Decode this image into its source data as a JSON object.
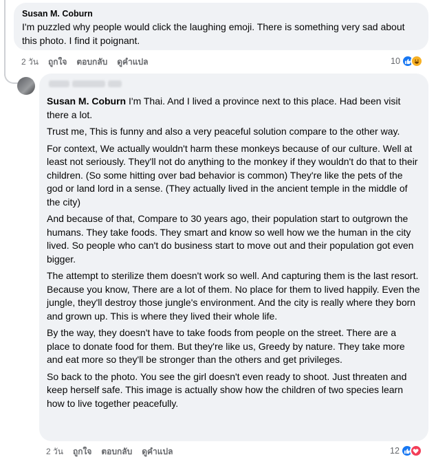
{
  "comment": {
    "author": "Susan M. Coburn",
    "text": "I'm puzzled why people would click the laughing emoji. There is something very sad about this photo. I find it poignant.",
    "time": "2 วัน",
    "like_label": "ถูกใจ",
    "reply_label": "ตอบกลับ",
    "translate_label": "ดูคำแปล",
    "reaction_count": "10",
    "reactions": [
      "like-icon",
      "haha-icon"
    ]
  },
  "reply": {
    "mention": "Susan M. Coburn",
    "paragraphs": [
      " I'm Thai. And I lived a province next to this place. Had been visit there a lot.",
      "Trust me, This is funny and also a very peaceful solution compare to the other way.",
      "For context, We actually wouldn't harm these monkeys because of our culture. Well at least not seriously. They'll not do anything to the monkey if they wouldn't do that to their children. (So some hitting over bad behavior is common) They're like the pets of the god or land lord in a sense. (They actually lived in the ancient temple in the middle of the city)",
      "And because of that, Compare to 30 years ago, their population start to outgrown the humans. They take foods. They smart and know so well how we the human in the city lived. So people who can't do business start to move out and their population got even bigger.",
      "The attempt to sterilize them doesn't work so well. And capturing them is the last resort. Because you know, There are a lot of them. No place for them to lived happily. Even the jungle, they'll destroy those jungle's environment. And the city is really where they born and grown up. This is where they lived their whole life.",
      "By the way, they doesn't have to take foods from people on the street. There are a place to donate food for them. But they're like us, Greedy by nature. They take more and eat more so they'll be stronger than the others and get privileges.",
      "So back to the photo. You see the girl doesn't even ready to shoot. Just threaten and keep herself safe. This image is actually show how the children of two species learn how to live together peacefully."
    ],
    "time": "2 วัน",
    "like_label": "ถูกใจ",
    "reply_label": "ตอบกลับ",
    "translate_label": "ดูคำแปล",
    "reaction_count": "12",
    "reactions": [
      "like-icon",
      "love-icon"
    ]
  },
  "colors": {
    "bubble": "#f0f2f5",
    "secondary_text": "#65676b",
    "like": "#1877f2",
    "haha": "#f7b125",
    "love": "#f33e58"
  }
}
